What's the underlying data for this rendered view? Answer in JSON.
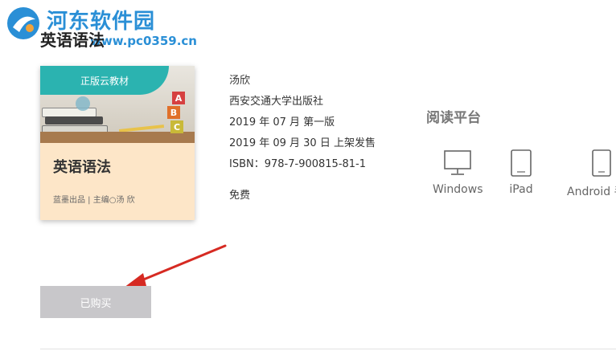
{
  "watermark": {
    "title": "河东软件园",
    "url": "www.pc0359.cn"
  },
  "page_title": "英语语法",
  "cover": {
    "ribbon": "正版云教材",
    "title": "英语语法",
    "footer": "蓝墨出品 | 主编○汤 欣",
    "blocks": [
      "A",
      "B",
      "C"
    ]
  },
  "book": {
    "author": "汤欣",
    "publisher": "西安交通大学出版社",
    "edition": "2019 年 07 月 第一版",
    "release": "2019 年 09 月 30 日 上架发售",
    "isbn": "ISBN：978-7-900815-81-1",
    "price": "免费"
  },
  "platforms": {
    "title": "阅读平台",
    "items": [
      {
        "label": "Windows",
        "icon": "monitor-icon"
      },
      {
        "label": "iPad",
        "icon": "tablet-icon"
      },
      {
        "label": "Android 手",
        "icon": "phone-icon"
      }
    ]
  },
  "buy_button": {
    "label": "已购买"
  },
  "colors": {
    "ribbon": "#2bb3b0",
    "cover_bg": "#fde6c8",
    "button_bg": "#c8c7ca",
    "arrow": "#d62a22",
    "watermark": "#2a8fd6"
  }
}
